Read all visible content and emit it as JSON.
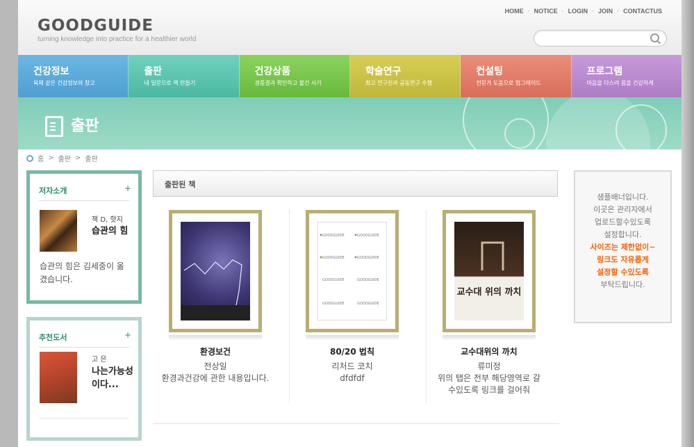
{
  "site": {
    "logo": "GOODGUIDE",
    "tagline": "turning knowledge into practice for a healthier world"
  },
  "topnav": [
    "HOME",
    "NOTICE",
    "LOGIN",
    "JOIN",
    "CONTACTUS"
  ],
  "search": {
    "placeholder": ""
  },
  "gnb": [
    {
      "title": "건강정보",
      "sub": "육체 같은 건강정보의 창고",
      "color": "#5aaad9"
    },
    {
      "title": "출판",
      "sub": "내 일문으로 책 만들기",
      "color": "#5ac6b0"
    },
    {
      "title": "건강상품",
      "sub": "경품결과 확인하고 물건 사기",
      "color": "#7ac84e"
    },
    {
      "title": "학술연구",
      "sub": "최고 연구진과 공동연구 수행",
      "color": "#c8c242"
    },
    {
      "title": "컨설팅",
      "sub": "전문가 도움으로 업그레이드",
      "color": "#e07e6a"
    },
    {
      "title": "프로그램",
      "sub": "마음을 다스려 몸을 건강하게",
      "color": "#b988cf"
    }
  ],
  "banner": {
    "title": "출판"
  },
  "breadcrumb": {
    "home": "홈",
    "sep1": ">",
    "level1": "출판",
    "sep2": ">",
    "level2": "출판"
  },
  "author_box": {
    "heading": "저자소개",
    "plus": "+",
    "author": "잭 D, 핫지",
    "title": "습관의 힘",
    "desc": "습관의 힘은 김세중이 옮겼습니다."
  },
  "recommend_box": {
    "heading": "추천도서",
    "plus": "+",
    "author": "고 은",
    "title": "나는가능성이다..."
  },
  "books_section": {
    "heading": "출판된 책"
  },
  "books": [
    {
      "title": "환경보건",
      "author": "전상일",
      "desc": "환경과건강에 관한 내용입니다."
    },
    {
      "title": "80/20 법칙",
      "author": "리처드 코치",
      "desc": "dfdfdf"
    },
    {
      "title": "교수대위의 까치",
      "author": "류미정",
      "desc": "위의 탭은 전부 해당영역로 갈수있도록 링크를 걸어줘"
    }
  ],
  "cover_texts": {
    "gallows_title": "교수대 위의 까치"
  },
  "right_banner": {
    "line1": "샘플배너입니다.",
    "line2": "이곳은 관리자에서",
    "line3": "업로드할수있도록",
    "line4": "설정합니다.",
    "hl1": "사이즈는 제한없이~",
    "hl2": "링크도 자유롭게",
    "hl3": "설정할 수있도록",
    "line5": "부탁드립니다."
  }
}
